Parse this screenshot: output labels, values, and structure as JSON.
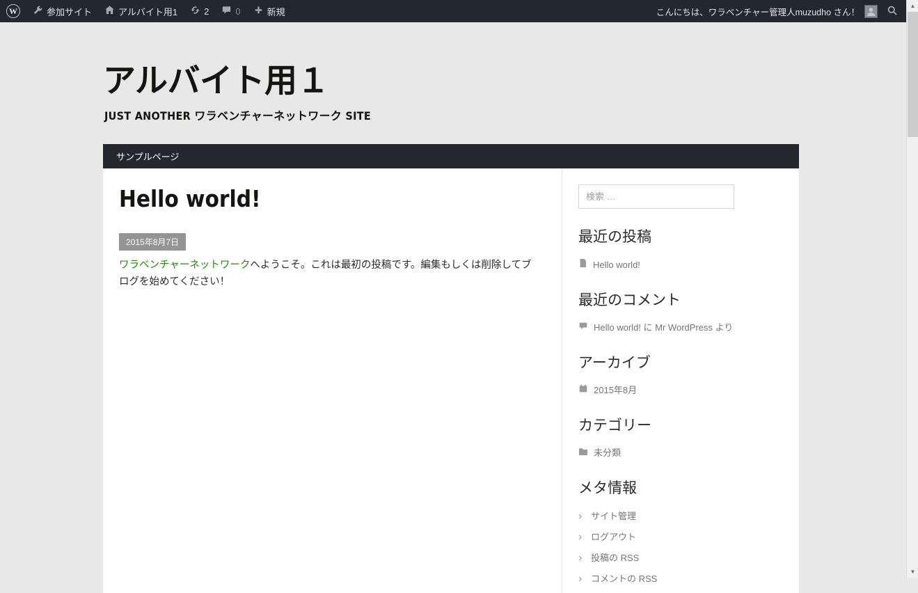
{
  "admin_bar": {
    "my_sites_label": "参加サイト",
    "site_name": "アルバイト用1",
    "updates_count": "2",
    "comments_count": "0",
    "new_label": "新規",
    "greeting": "こんにちは、ワラベンチャー管理人muzudho さん！"
  },
  "header": {
    "site_title": "アルバイト用１",
    "tagline": "Just another ワラベンチャーネットワーク site"
  },
  "nav": {
    "items": [
      {
        "label": "サンプルページ"
      }
    ]
  },
  "article": {
    "title": "Hello world!",
    "date": "2015年8月7日",
    "body_link": "ワラベンチャーネットワーク",
    "body_rest": "へようこそ。これは最初の投稿です。編集もしくは削除してブログを始めてください！"
  },
  "sidebar": {
    "search_placeholder": "検索 …",
    "recent_posts": {
      "title": "最近の投稿",
      "items": [
        "Hello world!"
      ]
    },
    "recent_comments": {
      "title": "最近のコメント",
      "item": {
        "comment_link": "Hello world!",
        "particle1": " に ",
        "author_link": "Mr WordPress",
        "particle2": " より"
      }
    },
    "archives": {
      "title": "アーカイブ",
      "items": [
        "2015年8月"
      ]
    },
    "categories": {
      "title": "カテゴリー",
      "items": [
        "未分類"
      ]
    },
    "meta": {
      "title": "メタ情報",
      "items": [
        "サイト管理",
        "ログアウト",
        "投稿の RSS",
        "コメントの RSS"
      ]
    }
  },
  "colors": {
    "admin_bar_bg": "#23282d",
    "nav_bg": "#24272c",
    "link_green": "#24890d",
    "date_badge_bg": "#949494",
    "page_bg": "#e8e8e8"
  }
}
